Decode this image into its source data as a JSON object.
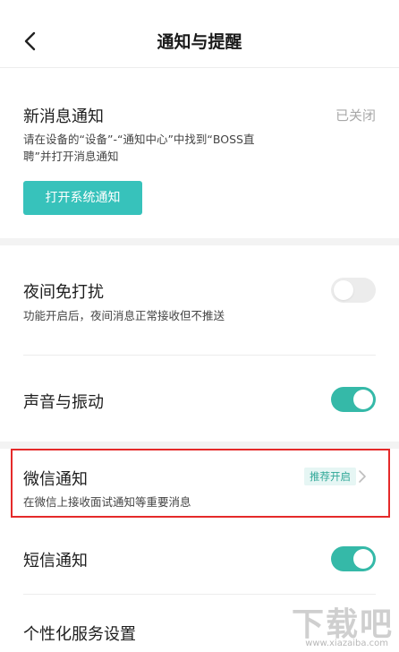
{
  "header": {
    "title": "通知与提醒"
  },
  "new_message": {
    "label": "新消息通知",
    "status": "已关闭",
    "desc_line1": "请在设备的“设备”-“通知中心”中找到“BOSS直",
    "desc_line2": "聘”并打开消息通知",
    "button_label": "打开系统通知"
  },
  "night": {
    "label": "夜间免打扰",
    "desc": "功能开启后，夜间消息正常接收但不推送",
    "enabled": false
  },
  "sound": {
    "label": "声音与振动",
    "enabled": true
  },
  "wechat": {
    "label": "微信通知",
    "desc": "在微信上接收面试通知等重要消息",
    "badge": "推荐开启"
  },
  "sms": {
    "label": "短信通知",
    "enabled": true
  },
  "personal": {
    "label": "个性化服务设置"
  },
  "watermark": {
    "main": "下载吧",
    "sub": "www.xiazaiba.com"
  },
  "colors": {
    "accent": "#37c2bb",
    "toggle_on": "#35b9a8",
    "highlight_border": "#e52a2a"
  }
}
